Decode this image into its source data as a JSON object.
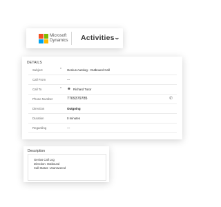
{
  "brand": {
    "logo_line1": "Microsoft",
    "logo_line2": "Dynamics",
    "colors": [
      "#f25022",
      "#7fba00",
      "#00a4ef",
      "#ffb900"
    ]
  },
  "header": {
    "title": "Activities",
    "chevron_icon": "chevron-down-icon"
  },
  "details": {
    "heading": "DETAILS",
    "required_marker": "*",
    "rows": [
      {
        "label": "Subject",
        "value": "Genius Autolog - Outbound Call"
      },
      {
        "label": "Call From",
        "value": "---"
      },
      {
        "label": "Call To",
        "value": "Richard Tutor",
        "icon": "contact-icon"
      },
      {
        "label": "Phone Number",
        "value": "7709379785",
        "icon": "phone-icon"
      },
      {
        "label": "Direction",
        "value": "Outgoing"
      },
      {
        "label": "Duration",
        "value": "0 minutes"
      },
      {
        "label": "Regarding",
        "value": "---"
      }
    ]
  },
  "description": {
    "heading": "Description",
    "lines": [
      "Genius Call Log",
      "Direction: Outbound",
      "Call Status: Unanswered"
    ]
  }
}
